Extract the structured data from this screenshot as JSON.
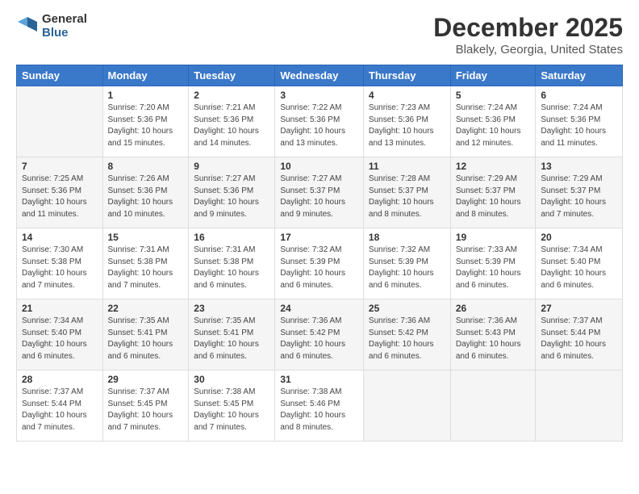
{
  "logo": {
    "general": "General",
    "blue": "Blue"
  },
  "header": {
    "title": "December 2025",
    "subtitle": "Blakely, Georgia, United States"
  },
  "calendar": {
    "days": [
      "Sunday",
      "Monday",
      "Tuesday",
      "Wednesday",
      "Thursday",
      "Friday",
      "Saturday"
    ],
    "weeks": [
      [
        {
          "day": "",
          "info": ""
        },
        {
          "day": "1",
          "info": "Sunrise: 7:20 AM\nSunset: 5:36 PM\nDaylight: 10 hours\nand 15 minutes."
        },
        {
          "day": "2",
          "info": "Sunrise: 7:21 AM\nSunset: 5:36 PM\nDaylight: 10 hours\nand 14 minutes."
        },
        {
          "day": "3",
          "info": "Sunrise: 7:22 AM\nSunset: 5:36 PM\nDaylight: 10 hours\nand 13 minutes."
        },
        {
          "day": "4",
          "info": "Sunrise: 7:23 AM\nSunset: 5:36 PM\nDaylight: 10 hours\nand 13 minutes."
        },
        {
          "day": "5",
          "info": "Sunrise: 7:24 AM\nSunset: 5:36 PM\nDaylight: 10 hours\nand 12 minutes."
        },
        {
          "day": "6",
          "info": "Sunrise: 7:24 AM\nSunset: 5:36 PM\nDaylight: 10 hours\nand 11 minutes."
        }
      ],
      [
        {
          "day": "7",
          "info": "Sunrise: 7:25 AM\nSunset: 5:36 PM\nDaylight: 10 hours\nand 11 minutes."
        },
        {
          "day": "8",
          "info": "Sunrise: 7:26 AM\nSunset: 5:36 PM\nDaylight: 10 hours\nand 10 minutes."
        },
        {
          "day": "9",
          "info": "Sunrise: 7:27 AM\nSunset: 5:36 PM\nDaylight: 10 hours\nand 9 minutes."
        },
        {
          "day": "10",
          "info": "Sunrise: 7:27 AM\nSunset: 5:37 PM\nDaylight: 10 hours\nand 9 minutes."
        },
        {
          "day": "11",
          "info": "Sunrise: 7:28 AM\nSunset: 5:37 PM\nDaylight: 10 hours\nand 8 minutes."
        },
        {
          "day": "12",
          "info": "Sunrise: 7:29 AM\nSunset: 5:37 PM\nDaylight: 10 hours\nand 8 minutes."
        },
        {
          "day": "13",
          "info": "Sunrise: 7:29 AM\nSunset: 5:37 PM\nDaylight: 10 hours\nand 7 minutes."
        }
      ],
      [
        {
          "day": "14",
          "info": "Sunrise: 7:30 AM\nSunset: 5:38 PM\nDaylight: 10 hours\nand 7 minutes."
        },
        {
          "day": "15",
          "info": "Sunrise: 7:31 AM\nSunset: 5:38 PM\nDaylight: 10 hours\nand 7 minutes."
        },
        {
          "day": "16",
          "info": "Sunrise: 7:31 AM\nSunset: 5:38 PM\nDaylight: 10 hours\nand 6 minutes."
        },
        {
          "day": "17",
          "info": "Sunrise: 7:32 AM\nSunset: 5:39 PM\nDaylight: 10 hours\nand 6 minutes."
        },
        {
          "day": "18",
          "info": "Sunrise: 7:32 AM\nSunset: 5:39 PM\nDaylight: 10 hours\nand 6 minutes."
        },
        {
          "day": "19",
          "info": "Sunrise: 7:33 AM\nSunset: 5:39 PM\nDaylight: 10 hours\nand 6 minutes."
        },
        {
          "day": "20",
          "info": "Sunrise: 7:34 AM\nSunset: 5:40 PM\nDaylight: 10 hours\nand 6 minutes."
        }
      ],
      [
        {
          "day": "21",
          "info": "Sunrise: 7:34 AM\nSunset: 5:40 PM\nDaylight: 10 hours\nand 6 minutes."
        },
        {
          "day": "22",
          "info": "Sunrise: 7:35 AM\nSunset: 5:41 PM\nDaylight: 10 hours\nand 6 minutes."
        },
        {
          "day": "23",
          "info": "Sunrise: 7:35 AM\nSunset: 5:41 PM\nDaylight: 10 hours\nand 6 minutes."
        },
        {
          "day": "24",
          "info": "Sunrise: 7:36 AM\nSunset: 5:42 PM\nDaylight: 10 hours\nand 6 minutes."
        },
        {
          "day": "25",
          "info": "Sunrise: 7:36 AM\nSunset: 5:42 PM\nDaylight: 10 hours\nand 6 minutes."
        },
        {
          "day": "26",
          "info": "Sunrise: 7:36 AM\nSunset: 5:43 PM\nDaylight: 10 hours\nand 6 minutes."
        },
        {
          "day": "27",
          "info": "Sunrise: 7:37 AM\nSunset: 5:44 PM\nDaylight: 10 hours\nand 6 minutes."
        }
      ],
      [
        {
          "day": "28",
          "info": "Sunrise: 7:37 AM\nSunset: 5:44 PM\nDaylight: 10 hours\nand 7 minutes."
        },
        {
          "day": "29",
          "info": "Sunrise: 7:37 AM\nSunset: 5:45 PM\nDaylight: 10 hours\nand 7 minutes."
        },
        {
          "day": "30",
          "info": "Sunrise: 7:38 AM\nSunset: 5:45 PM\nDaylight: 10 hours\nand 7 minutes."
        },
        {
          "day": "31",
          "info": "Sunrise: 7:38 AM\nSunset: 5:46 PM\nDaylight: 10 hours\nand 8 minutes."
        },
        {
          "day": "",
          "info": ""
        },
        {
          "day": "",
          "info": ""
        },
        {
          "day": "",
          "info": ""
        }
      ]
    ]
  }
}
